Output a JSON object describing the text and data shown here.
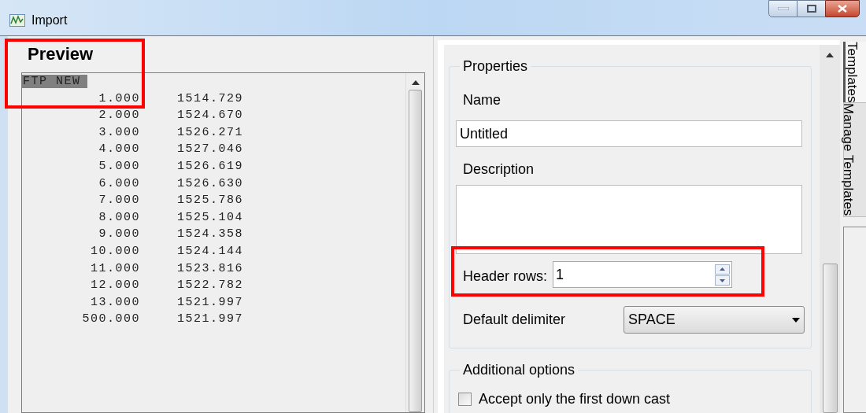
{
  "window": {
    "title": "Import"
  },
  "preview": {
    "title": "Preview",
    "header_line": "FTP NEW",
    "rows": [
      [
        "1.000",
        "1514.729"
      ],
      [
        "2.000",
        "1524.670"
      ],
      [
        "3.000",
        "1526.271"
      ],
      [
        "4.000",
        "1527.046"
      ],
      [
        "5.000",
        "1526.619"
      ],
      [
        "6.000",
        "1526.630"
      ],
      [
        "7.000",
        "1525.786"
      ],
      [
        "8.000",
        "1525.104"
      ],
      [
        "9.000",
        "1524.358"
      ],
      [
        "10.000",
        "1524.144"
      ],
      [
        "11.000",
        "1523.816"
      ],
      [
        "12.000",
        "1522.782"
      ],
      [
        "13.000",
        "1521.997"
      ],
      [
        "500.000",
        "1521.997"
      ]
    ]
  },
  "properties": {
    "title": "Properties",
    "name_label": "Name",
    "name_value": "Untitled",
    "description_label": "Description",
    "header_rows_label": "Header rows:",
    "header_rows_value": "1",
    "delimiter_label": "Default delimiter",
    "delimiter_value": "SPACE"
  },
  "additional_options": {
    "title": "Additional options",
    "options": [
      {
        "label": "Accept only the first down cast",
        "checked": false
      }
    ]
  },
  "side_tabs": [
    {
      "label": "Templates",
      "selected": true
    },
    {
      "label": "Manage Templates",
      "selected": false
    }
  ]
}
